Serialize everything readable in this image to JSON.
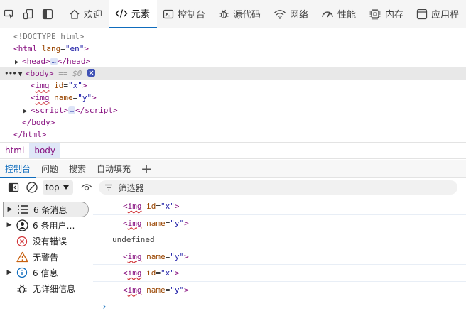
{
  "toolbar": {
    "tabs": [
      {
        "label": "欢迎",
        "icon": "home-icon"
      },
      {
        "label": "元素",
        "icon": "code-icon"
      },
      {
        "label": "控制台",
        "icon": "console-icon"
      },
      {
        "label": "源代码",
        "icon": "bug-icon"
      },
      {
        "label": "网络",
        "icon": "wifi-icon"
      },
      {
        "label": "性能",
        "icon": "gauge-icon"
      },
      {
        "label": "内存",
        "icon": "chip-icon"
      },
      {
        "label": "应用程",
        "icon": "app-icon"
      }
    ],
    "active_tab": "元素"
  },
  "tree": {
    "doctype": "<!DOCTYPE html>",
    "html_tag": "html",
    "lang_attr": "lang",
    "lang_val": "\"en\"",
    "head_tag": "head",
    "body_tag": "body",
    "body_note": "== $0",
    "img1": {
      "tag": "img",
      "attr": "id",
      "val": "\"x\""
    },
    "img2": {
      "tag": "img",
      "attr": "name",
      "val": "\"y\""
    },
    "script_tag": "script",
    "ellipsis": "…"
  },
  "breadcrumbs": [
    {
      "label": "html"
    },
    {
      "label": "body"
    }
  ],
  "drawer": {
    "tabs": [
      {
        "label": "控制台"
      },
      {
        "label": "问题"
      },
      {
        "label": "搜索"
      },
      {
        "label": "自动填充"
      }
    ],
    "add_label": "+"
  },
  "console_toolbar": {
    "context": "top",
    "filter_placeholder": "筛选器"
  },
  "sidebar": {
    "items": [
      {
        "label": "6 条消息",
        "icon": "list-icon"
      },
      {
        "label": "6 条用户…",
        "icon": "user-icon"
      },
      {
        "label": "没有错误",
        "icon": "error-icon"
      },
      {
        "label": "无警告",
        "icon": "warning-icon"
      },
      {
        "label": "6 信息",
        "icon": "info-icon"
      },
      {
        "label": "无详细信息",
        "icon": "bug-verbose-icon"
      }
    ]
  },
  "messages": {
    "m1": {
      "tag": "img",
      "attr": "id",
      "val": "\"x\""
    },
    "m2": {
      "tag": "img",
      "attr": "name",
      "val": "\"y\""
    },
    "m3": "undefined",
    "m4": {
      "tag": "img",
      "attr": "name",
      "val": "\"y\""
    },
    "m5": {
      "tag": "img",
      "attr": "id",
      "val": "\"x\""
    },
    "m6": {
      "tag": "img",
      "attr": "name",
      "val": "\"y\""
    },
    "prompt": "›"
  },
  "colors": {
    "accent": "#0f6cbd",
    "tag": "#881280",
    "attr": "#994500",
    "value": "#1a1aa6"
  }
}
